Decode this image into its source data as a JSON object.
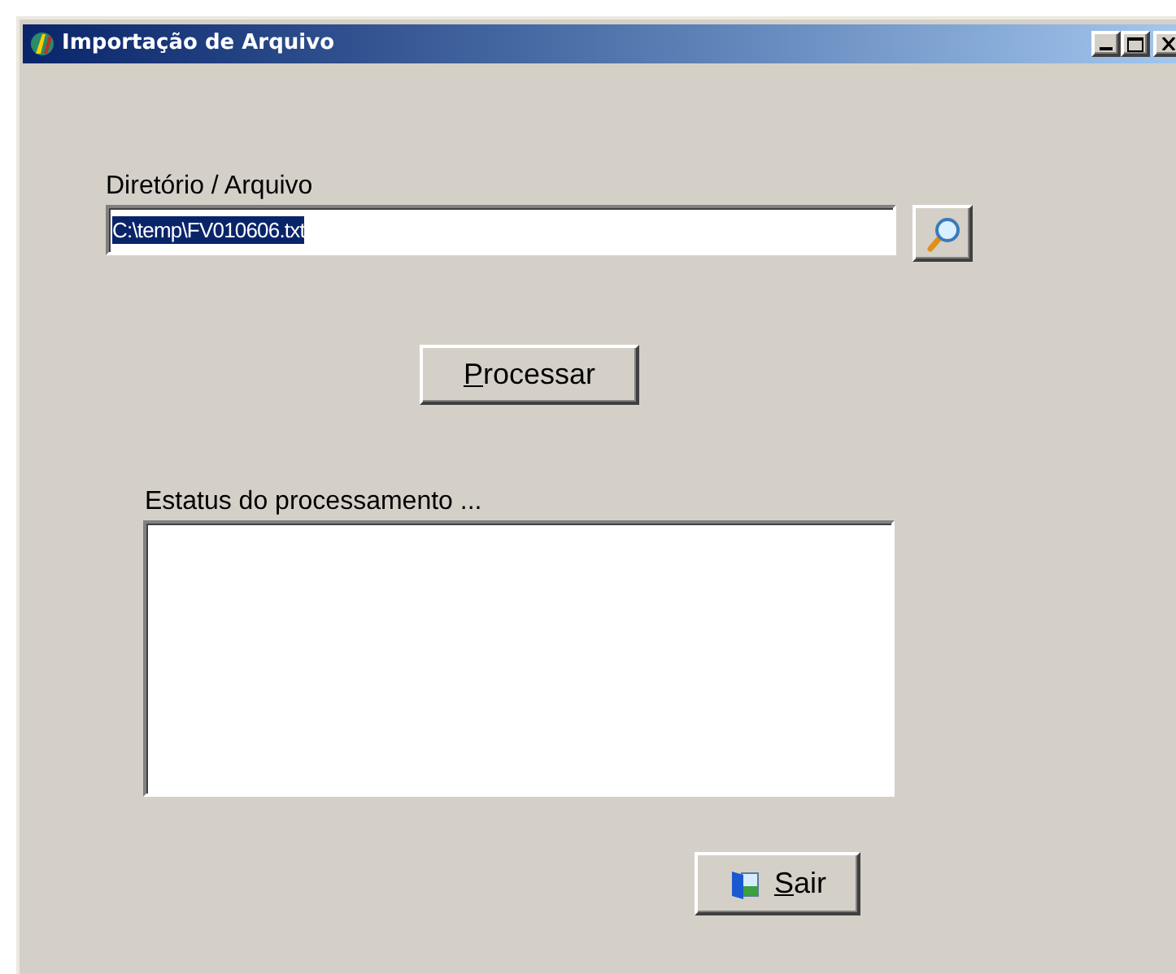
{
  "window": {
    "title": "Importação de Arquivo"
  },
  "file_field": {
    "label": "Diretório / Arquivo",
    "value": "C:\\temp\\FV010606.txt",
    "selected": true
  },
  "process_button": {
    "label": "Processar"
  },
  "status": {
    "label": "Estatus do processamento ..."
  },
  "exit_button": {
    "label": "Sair"
  }
}
